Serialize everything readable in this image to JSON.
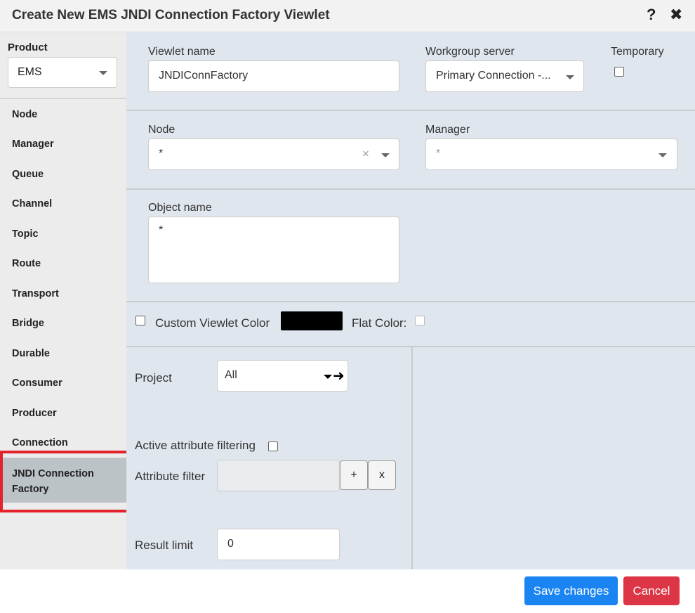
{
  "title": "Create New EMS JNDI Connection Factory Viewlet",
  "header": {
    "help": "?",
    "close": "✖"
  },
  "sidebar": {
    "product_label": "Product",
    "product_value": "EMS",
    "items": [
      "Node",
      "Manager",
      "Queue",
      "Channel",
      "Topic",
      "Route",
      "Transport",
      "Bridge",
      "Durable",
      "Consumer",
      "Producer",
      "Connection"
    ],
    "active_item": "JNDI Connection Factory"
  },
  "form": {
    "viewlet_name_label": "Viewlet name",
    "viewlet_name_value": "JNDIConnFactory",
    "workgroup_label": "Workgroup server",
    "workgroup_value": "Primary Connection -...",
    "temporary_label": "Temporary",
    "node_label": "Node",
    "node_value": "*",
    "node_clear": "×",
    "manager_label": "Manager",
    "manager_placeholder": "*",
    "object_name_label": "Object name",
    "object_name_value": "*",
    "custom_color_label": "Custom Viewlet Color",
    "flat_color_label": "Flat Color:",
    "project_label": "Project",
    "project_value": "All",
    "active_filter_label": "Active attribute filtering",
    "attribute_filter_label": "Attribute filter",
    "add_label": "+",
    "remove_label": "x",
    "result_limit_label": "Result limit",
    "result_limit_value": "0"
  },
  "footer": {
    "save": "Save changes",
    "cancel": "Cancel"
  },
  "colors": {
    "primary": "#1a84f3",
    "danger": "#dc3545",
    "highlight": "#e3232b",
    "swatch": "#000000"
  }
}
